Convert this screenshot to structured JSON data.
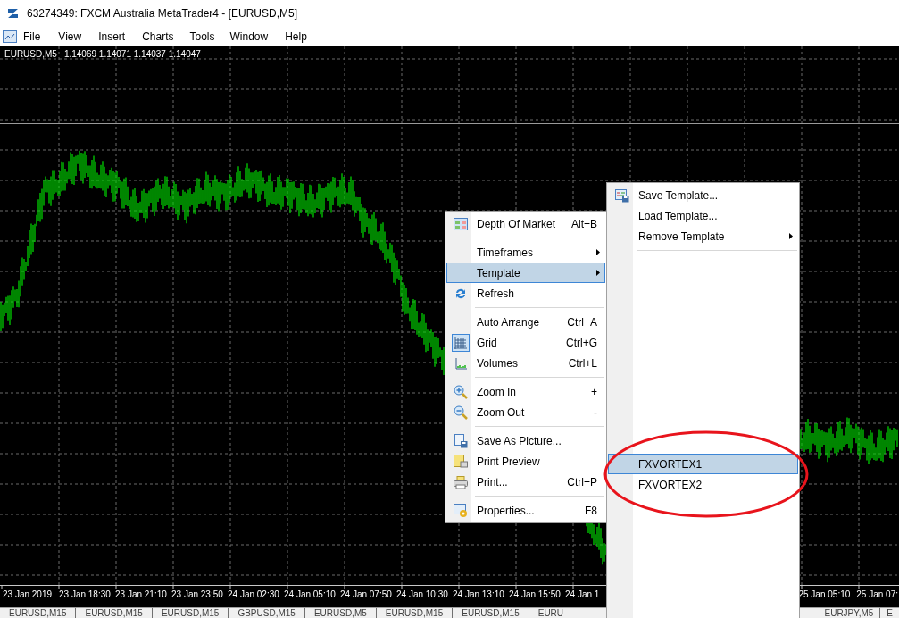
{
  "window": {
    "title": "63274349: FXCM Australia MetaTrader4 - [EURUSD,M5]"
  },
  "menu_bar": [
    "File",
    "View",
    "Insert",
    "Charts",
    "Tools",
    "Window",
    "Help"
  ],
  "chart": {
    "symbol": "EURUSD,M5",
    "quote": "1.14069 1.14071 1.14037 1.14047",
    "time_labels_left": [
      "23 Jan 2019",
      "23 Jan 18:30",
      "23 Jan 21:10",
      "23 Jan 23:50",
      "24 Jan 02:30",
      "24 Jan 05:10",
      "24 Jan 07:50",
      "24 Jan 10:30",
      "24 Jan 13:10",
      "24 Jan 15:50",
      "24 Jan 1"
    ],
    "time_labels_right": [
      "25 Jan 05:10",
      "25 Jan 07:"
    ]
  },
  "context_menu": {
    "items": [
      {
        "kind": "item",
        "label": "Depth Of Market",
        "shortcut": "Alt+B",
        "submenu": false,
        "selected": false
      },
      {
        "kind": "separator"
      },
      {
        "kind": "item",
        "label": "Timeframes",
        "submenu": true,
        "selected": false
      },
      {
        "kind": "item",
        "label": "Template",
        "submenu": true,
        "selected": true
      },
      {
        "kind": "item",
        "label": "Refresh",
        "submenu": false,
        "selected": false
      },
      {
        "kind": "separator"
      },
      {
        "kind": "item",
        "label": "Auto Arrange",
        "shortcut": "Ctrl+A",
        "submenu": false,
        "selected": false
      },
      {
        "kind": "item",
        "label": "Grid",
        "shortcut": "Ctrl+G",
        "submenu": false,
        "selected": false,
        "checked": true
      },
      {
        "kind": "item",
        "label": "Volumes",
        "shortcut": "Ctrl+L",
        "submenu": false,
        "selected": false,
        "checked": false
      },
      {
        "kind": "separator"
      },
      {
        "kind": "item",
        "label": "Zoom In",
        "shortcut": "+",
        "submenu": false,
        "selected": false
      },
      {
        "kind": "item",
        "label": "Zoom Out",
        "shortcut": "-",
        "submenu": false,
        "selected": false
      },
      {
        "kind": "separator"
      },
      {
        "kind": "item",
        "label": "Save As Picture...",
        "submenu": false,
        "selected": false
      },
      {
        "kind": "item",
        "label": "Print Preview",
        "submenu": false,
        "selected": false
      },
      {
        "kind": "item",
        "label": "Print...",
        "shortcut": "Ctrl+P",
        "submenu": false,
        "selected": false
      },
      {
        "kind": "separator"
      },
      {
        "kind": "item",
        "label": "Properties...",
        "shortcut": "F8",
        "submenu": false,
        "selected": false
      }
    ]
  },
  "template_submenu": {
    "items": [
      {
        "kind": "item",
        "label": "Save Template...",
        "submenu": false,
        "selected": false
      },
      {
        "kind": "item",
        "label": "Load Template...",
        "submenu": false,
        "selected": false
      },
      {
        "kind": "item",
        "label": "Remove Template",
        "submenu": true,
        "selected": false
      },
      {
        "kind": "separator"
      },
      {
        "kind": "gap"
      },
      {
        "kind": "item",
        "label": "FXVORTEX1",
        "submenu": false,
        "selected": true
      },
      {
        "kind": "item",
        "label": "FXVORTEX2",
        "submenu": false,
        "selected": false
      }
    ]
  },
  "chart_tabs_left": [
    "EURUSD,M15",
    "EURUSD,M15",
    "EURUSD,M15",
    "GBPUSD,M15",
    "EURUSD,M5",
    "EURUSD,M15",
    "EURUSD,M15",
    "EURU"
  ],
  "chart_tabs_right": [
    "EURJPY,M5",
    "E"
  ]
}
